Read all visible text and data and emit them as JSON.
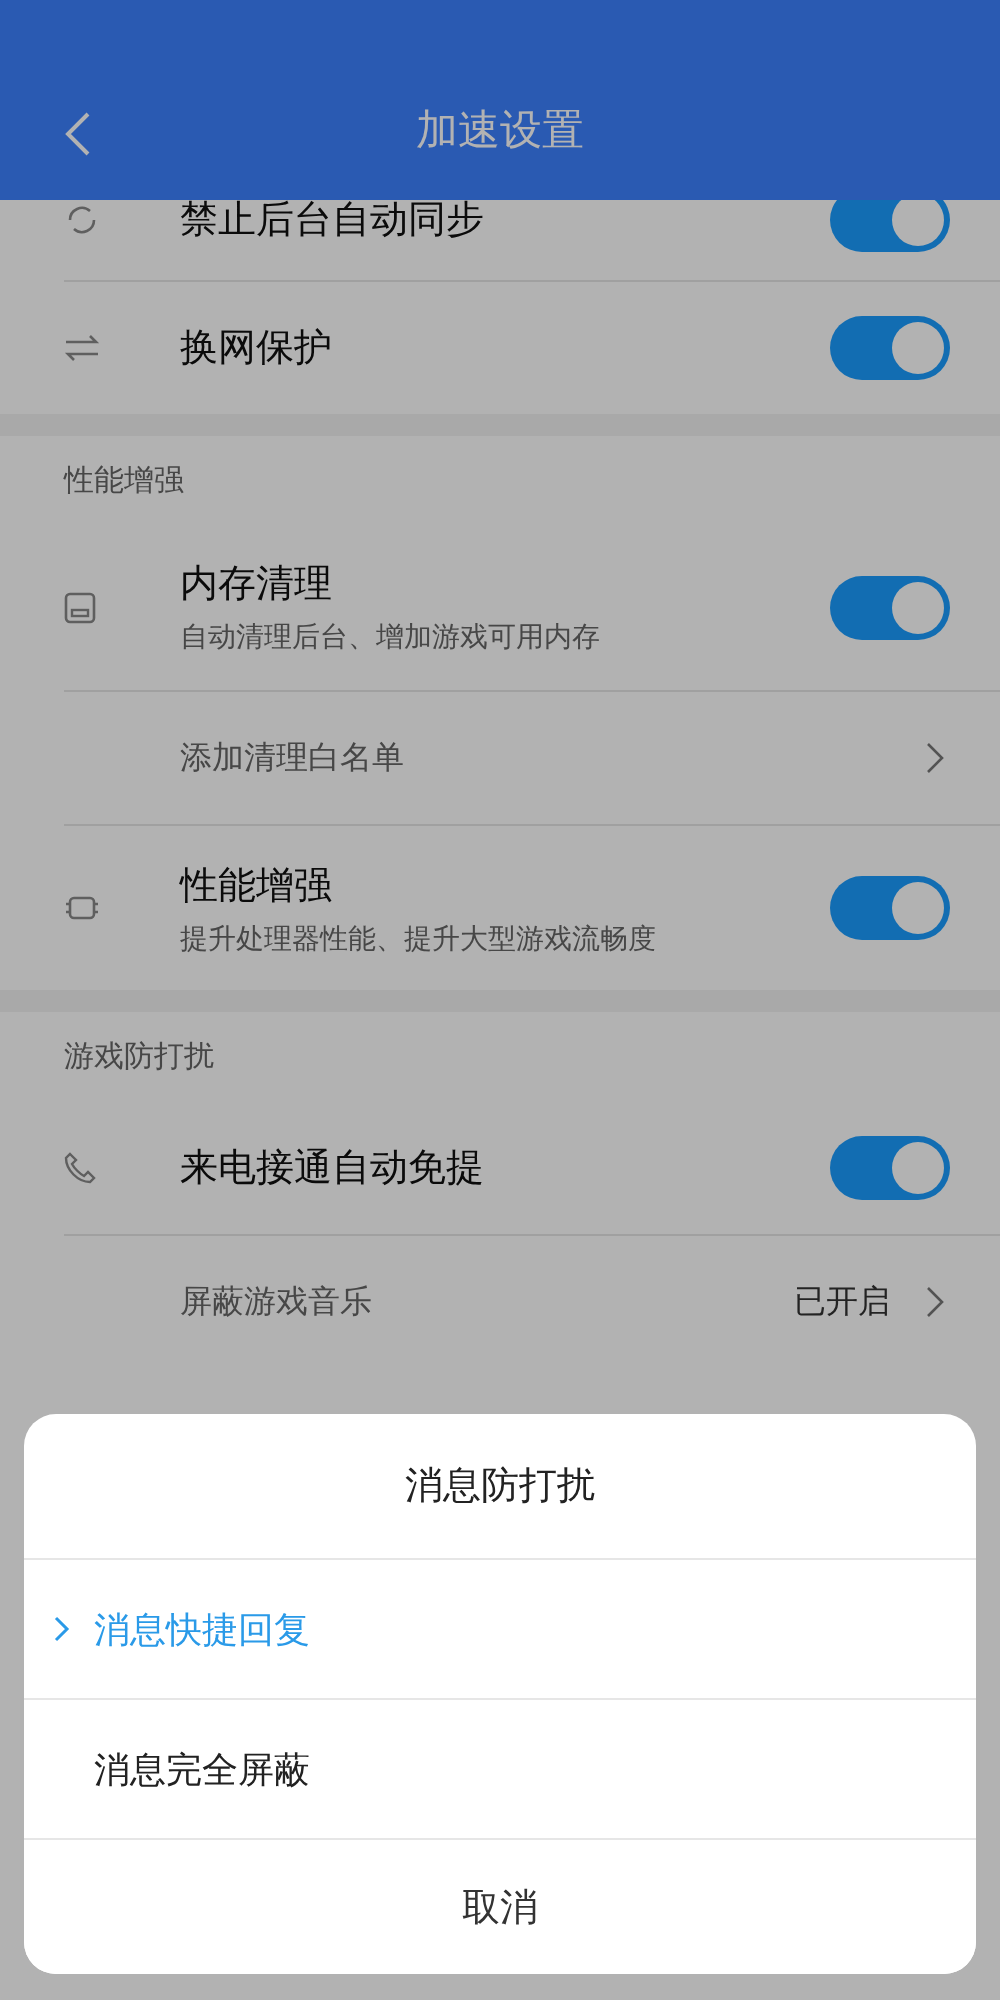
{
  "header": {
    "title": "加速设置"
  },
  "sections": [
    {
      "items": [
        {
          "kind": "toggle",
          "title": "禁止后台自动同步",
          "on": true
        },
        {
          "kind": "toggle",
          "title": "换网保护",
          "on": true
        }
      ]
    },
    {
      "title": "性能增强",
      "items": [
        {
          "kind": "toggle",
          "title": "内存清理",
          "subtitle": "自动清理后台、增加游戏可用内存",
          "on": true
        },
        {
          "kind": "link",
          "title": "添加清理白名单"
        },
        {
          "kind": "toggle",
          "title": "性能增强",
          "subtitle": "提升处理器性能、提升大型游戏流畅度",
          "on": true
        }
      ]
    },
    {
      "title": "游戏防打扰",
      "items": [
        {
          "kind": "toggle",
          "title": "来电接通自动免提",
          "on": true
        },
        {
          "kind": "link",
          "title": "屏蔽游戏音乐",
          "value": "已开启"
        }
      ]
    }
  ],
  "dialog": {
    "title": "消息防打扰",
    "options": [
      {
        "label": "消息快捷回复",
        "selected": true
      },
      {
        "label": "消息完全屏蔽",
        "selected": false
      }
    ],
    "cancel": "取消"
  }
}
